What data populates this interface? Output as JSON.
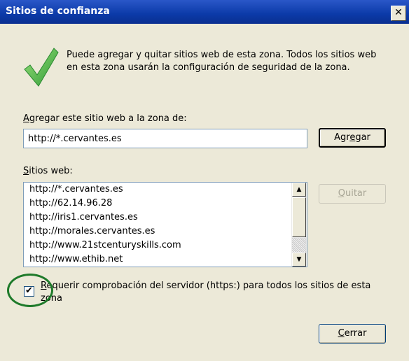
{
  "window": {
    "title": "Sitios de confianza",
    "close_glyph": "✕"
  },
  "info": {
    "icon": "checkmark-icon",
    "text": "Puede agregar y quitar sitios web de esta zona. Todos los sitios web en esta zona usarán la configuración de seguridad de la zona."
  },
  "add_section": {
    "label_accesskey": "A",
    "label_rest": "gregar este sitio web a la zona de:",
    "input_value": "http://*.cervantes.es",
    "add_button_pre": "Agr",
    "add_button_accesskey": "e",
    "add_button_post": "gar"
  },
  "sites_section": {
    "label_accesskey": "S",
    "label_rest": "itios web:",
    "items": [
      "http://*.cervantes.es",
      "http://62.14.96.28",
      "http://iris1.cervantes.es",
      "http://morales.cervantes.es",
      "http://www.21stcenturyskills.com",
      "http://www.ethib.net"
    ],
    "remove_button_accesskey": "Q",
    "remove_button_rest": "uitar"
  },
  "https_option": {
    "checked": true,
    "check_glyph": "✔",
    "label_accesskey": "R",
    "label_rest": "equerir comprobación del servidor (https:) para todos los sitios de esta zona"
  },
  "close_button": {
    "accesskey": "C",
    "rest": "errar"
  },
  "colors": {
    "titlebar": "#0b3aa8",
    "dialog_bg": "#ece9d8",
    "check_green": "#3bb54a",
    "highlight_circle": "#1e7a2a"
  }
}
